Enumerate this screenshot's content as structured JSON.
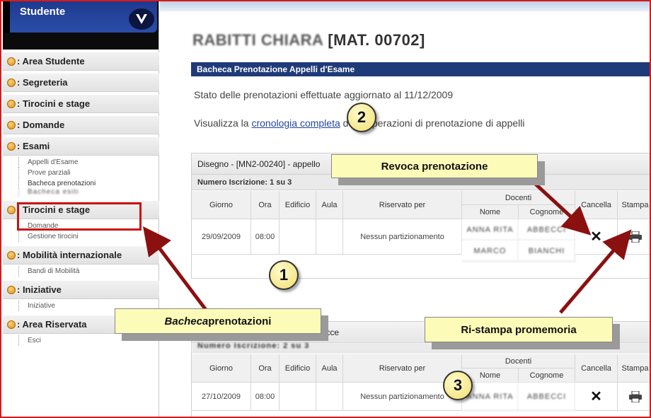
{
  "sidebar": {
    "title": "Studente",
    "items": [
      {
        "label": ": Area Studente",
        "sub": []
      },
      {
        "label": ": Segreteria",
        "sub": []
      },
      {
        "label": ": Tirocini e stage",
        "sub": []
      },
      {
        "label": ": Domande",
        "sub": []
      },
      {
        "label": ": Esami",
        "sub": [
          "Appelli d'Esame",
          "Prove parziali",
          "Bacheca prenotazioni",
          "Bacheca esiti"
        ]
      },
      {
        "label": ": Tirocini e stage",
        "sub": [
          "Domande",
          "Gestione tirocini"
        ]
      },
      {
        "label": ": Mobilità internazionale",
        "sub": [
          "Bandi di Mobilità"
        ]
      },
      {
        "label": ": Iniziative",
        "sub": [
          "Iniziative"
        ]
      },
      {
        "label": ": Area Riservata",
        "sub": [
          "Esci"
        ]
      }
    ]
  },
  "main": {
    "page_title_blurred": "RABITTI CHIARA",
    "page_title": " [MAT. 00702]",
    "section_bar": "Bacheca Prenotazione Appelli d'Esame",
    "status_text": "Stato delle prenotazioni effettuate aggiornato al 11/12/2009",
    "history_prefix": "Visualizza la ",
    "history_link": "cronologia completa",
    "history_suffix": " delle operazioni di prenotazione di appelli"
  },
  "table1": {
    "header": "Disegno - [MN2-00240] - appello",
    "num_iscrizione": "Numero Iscrizione: 1 su 3",
    "columns": {
      "giorno": "Giorno",
      "ora": "Ora",
      "edificio": "Edificio",
      "aula": "Aula",
      "riservato": "Riservato per",
      "docenti": "Docenti",
      "nome": "Nome",
      "cognome": "Cognome",
      "cancella": "Cancella",
      "stampa": "Stampa"
    },
    "row": {
      "giorno": "29/09/2009",
      "ora": "08:00",
      "riservato": "Nessun partizionamento",
      "nome1": "ANNA RITA",
      "cognome1": "ABBECCI",
      "nome2": "MARCO",
      "cognome2": "BIANCHI"
    }
  },
  "table2": {
    "header_suffix": "lecce",
    "num_iscrizione": "Numero Iscrizione: 2 su 3",
    "row": {
      "giorno": "27/10/2009",
      "ora": "08:00",
      "riservato": "Nessun partizionamento",
      "nome1": "ANNA RITA",
      "cognome1": "ABBECCI"
    }
  },
  "callouts": {
    "revoca": "Revoca prenotazione",
    "bacheca_italic": "Bacheca",
    "bacheca_rest": " prenotazioni",
    "ristampa": "Ri-stampa promemoria"
  },
  "markers": {
    "one": "1",
    "two": "2",
    "three": "3"
  },
  "colors": {
    "accent_red": "#8b1010",
    "section_blue": "#1f3a78",
    "callout_yellow": "#fdfbb8",
    "highlight_border": "#cc1111"
  }
}
